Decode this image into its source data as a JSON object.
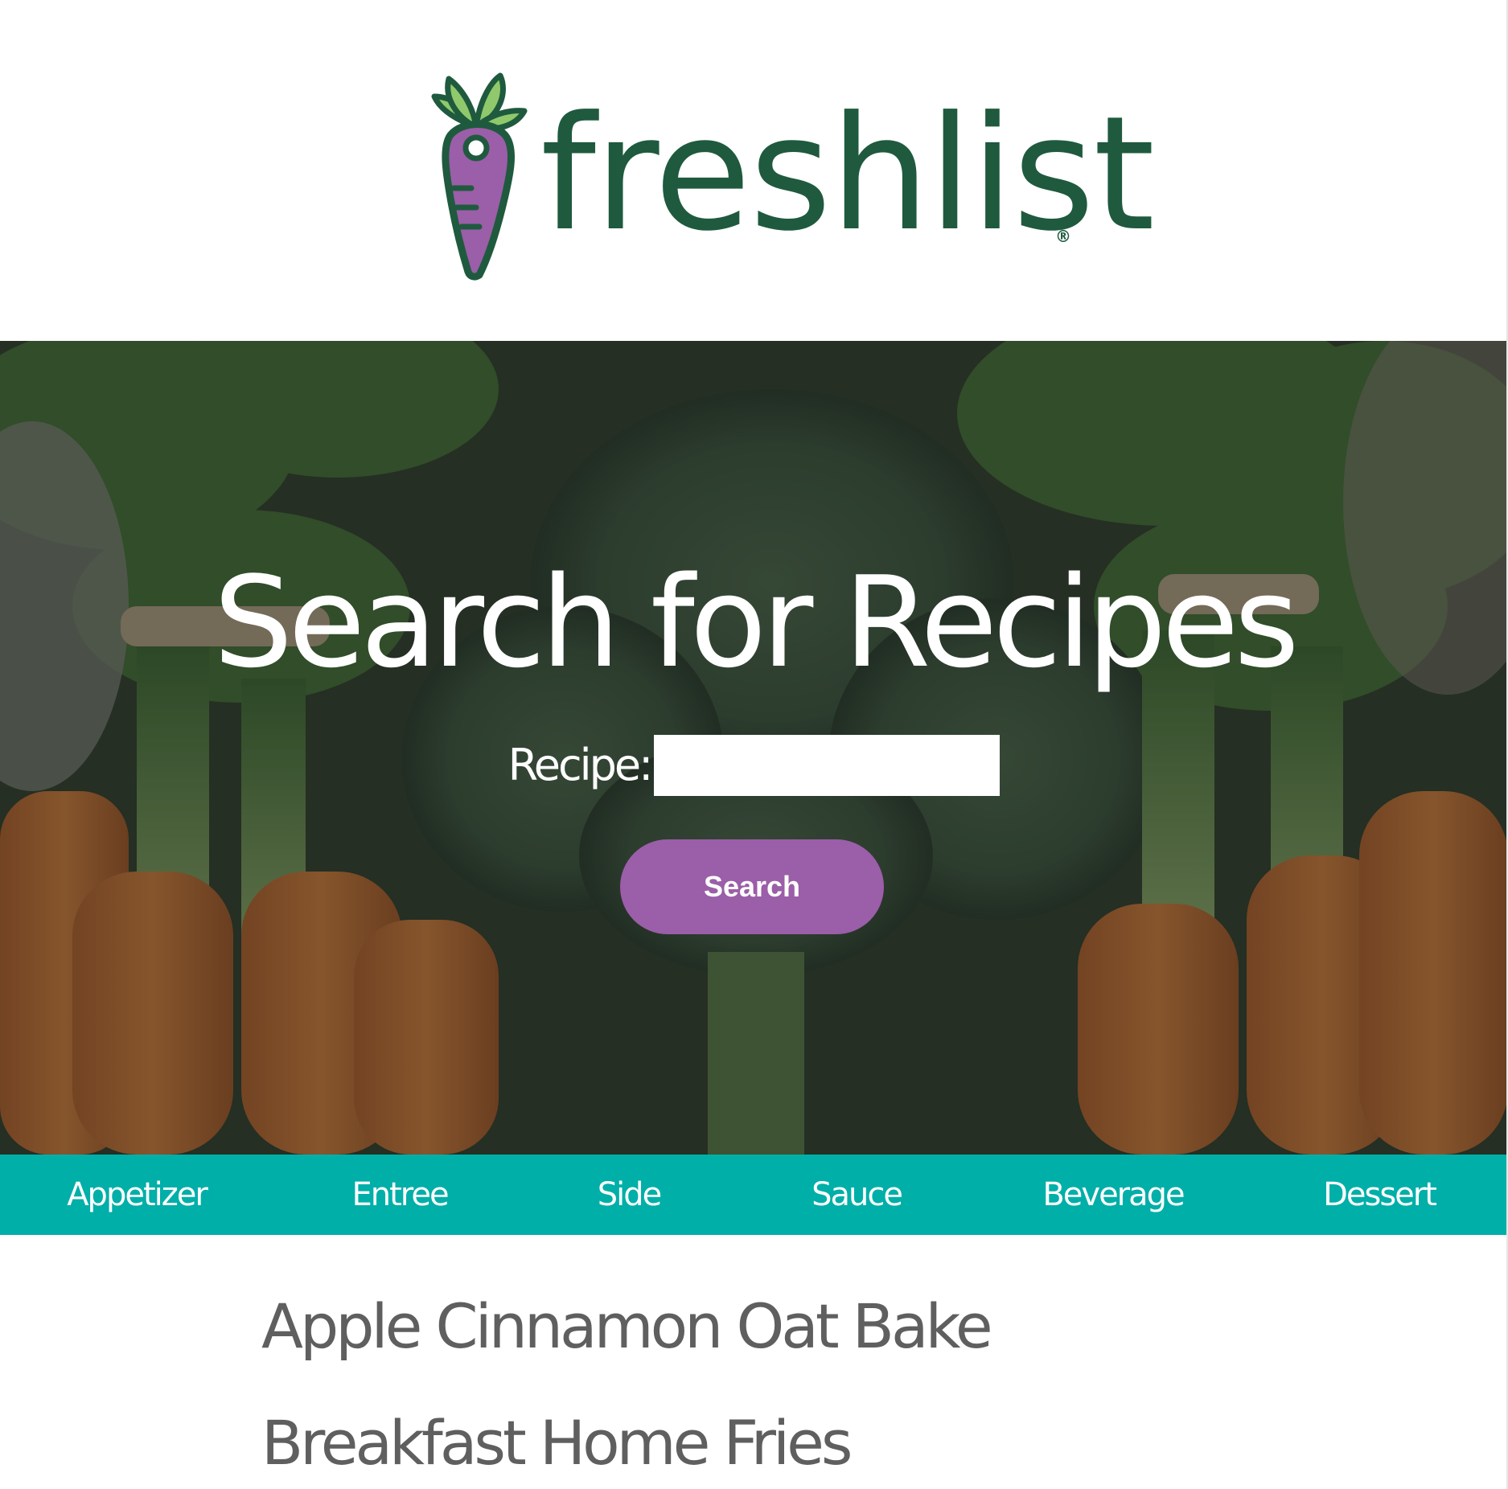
{
  "brand": {
    "name": "freshlist",
    "registered_mark": "®",
    "logo_icon": "carrot-icon",
    "colors": {
      "wordmark": "#1f5a3e",
      "carrot": "#9b5ea8",
      "leaf": "#8fc96b",
      "outline": "#1f5a3e"
    }
  },
  "hero": {
    "title": "Search for Recipes",
    "recipe_label": "Recipe:",
    "recipe_input": {
      "value": "",
      "placeholder": ""
    },
    "search_button": "Search",
    "colors": {
      "button": "#9b5ea8",
      "text": "#ffffff"
    }
  },
  "categories": {
    "items": [
      "Appetizer",
      "Entree",
      "Side",
      "Sauce",
      "Beverage",
      "Dessert"
    ],
    "color": "#00afa8"
  },
  "recipes": [
    "Apple Cinnamon Oat Bake",
    "Breakfast Home Fries"
  ]
}
